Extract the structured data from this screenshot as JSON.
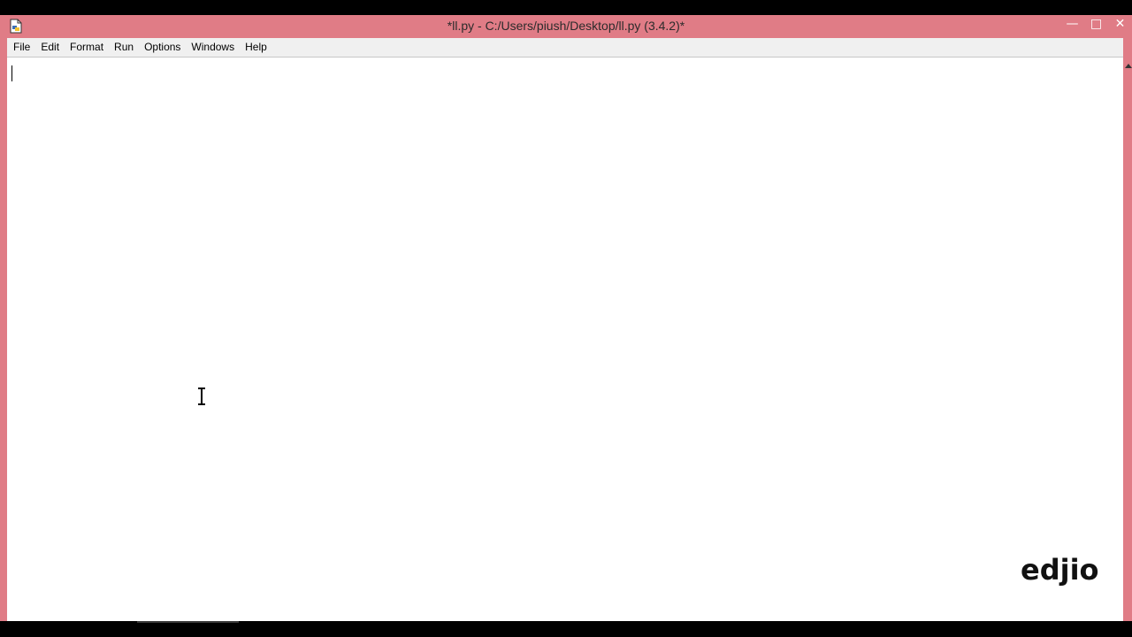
{
  "window": {
    "title": "*ll.py - C:/Users/piush/Desktop/ll.py (3.4.2)*",
    "controls": {
      "minimize": "—",
      "maximize": "□",
      "close": "✕"
    }
  },
  "menubar": {
    "items": [
      {
        "label": "File"
      },
      {
        "label": "Edit"
      },
      {
        "label": "Format"
      },
      {
        "label": "Run"
      },
      {
        "label": "Options"
      },
      {
        "label": "Windows"
      },
      {
        "label": "Help"
      }
    ]
  },
  "editor": {
    "content": ""
  },
  "icons": {
    "app": "idle-python-file-icon",
    "cursor": "i-beam-cursor-icon"
  },
  "colors": {
    "titlebar_accent": "#e07c86",
    "editor_background": "#ffffff",
    "menubar_background": "#f0f0f0"
  },
  "watermark": {
    "text": "edjio"
  }
}
